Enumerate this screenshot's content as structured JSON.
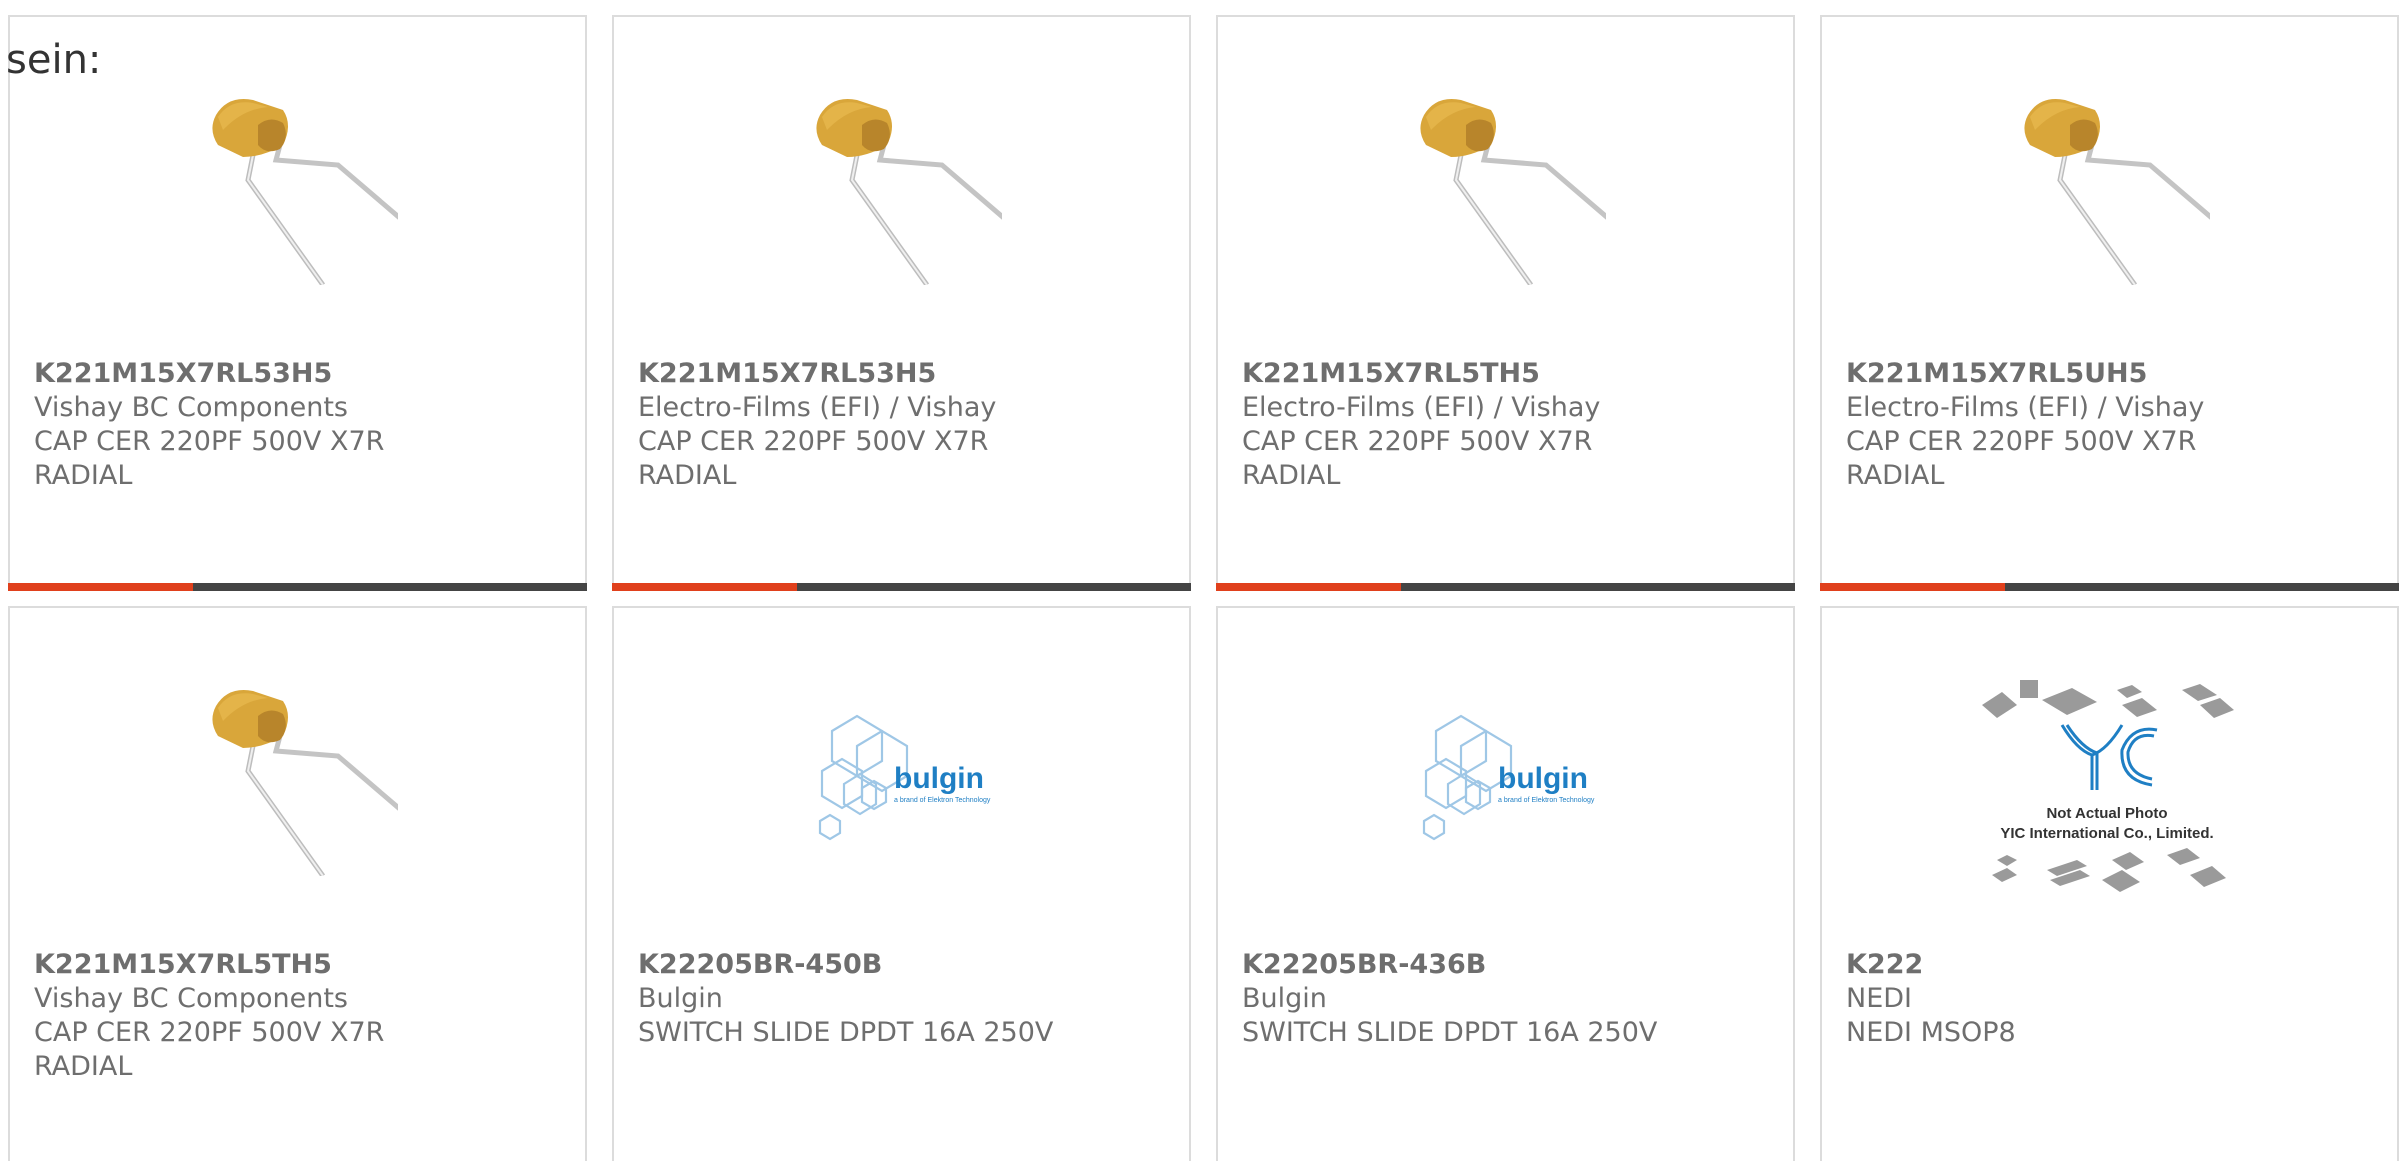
{
  "intro_text": "sein:",
  "colors": {
    "accent": "#e0401c",
    "bar_dark": "#444444",
    "border": "#dcdcdc",
    "text": "#6e6e6e",
    "capacitor_body": "#d9a63a",
    "bulgin_blue": "#1f7fc4"
  },
  "products": [
    {
      "part_number": "K221M15X7RL53H5",
      "manufacturer": "Vishay BC Components",
      "description_line1": "CAP CER 220PF 500V X7R",
      "description_line2": "RADIAL",
      "image": "capacitor-image",
      "bar_visible": true
    },
    {
      "part_number": "K221M15X7RL53H5",
      "manufacturer": "Electro-Films (EFI) / Vishay",
      "description_line1": "CAP CER 220PF 500V X7R",
      "description_line2": "RADIAL",
      "image": "capacitor-image",
      "bar_visible": true
    },
    {
      "part_number": "K221M15X7RL5TH5",
      "manufacturer": "Electro-Films (EFI) / Vishay",
      "description_line1": "CAP CER 220PF 500V X7R",
      "description_line2": "RADIAL",
      "image": "capacitor-image",
      "bar_visible": true
    },
    {
      "part_number": "K221M15X7RL5UH5",
      "manufacturer": "Electro-Films (EFI) / Vishay",
      "description_line1": "CAP CER 220PF 500V X7R",
      "description_line2": "RADIAL",
      "image": "capacitor-image",
      "bar_visible": true
    },
    {
      "part_number": "K221M15X7RL5TH5",
      "manufacturer": "Vishay BC Components",
      "description_line1": "CAP CER 220PF 500V X7R",
      "description_line2": "RADIAL",
      "image": "capacitor-image",
      "bar_visible": false
    },
    {
      "part_number": "K22205BR-450B",
      "manufacturer": "Bulgin",
      "description_line1": "SWITCH SLIDE DPDT 16A 250V",
      "description_line2": "",
      "image": "bulgin-logo",
      "logo_text": "bulgin",
      "logo_subtext": "a brand of Elektron Technology",
      "bar_visible": false
    },
    {
      "part_number": "K22205BR-436B",
      "manufacturer": "Bulgin",
      "description_line1": "SWITCH SLIDE DPDT 16A 250V",
      "description_line2": "",
      "image": "bulgin-logo",
      "logo_text": "bulgin",
      "logo_subtext": "a brand of Elektron Technology",
      "bar_visible": false
    },
    {
      "part_number": "K222",
      "manufacturer": "NEDI",
      "description_line1": "NEDI MSOP8",
      "description_line2": "",
      "image": "yic-placeholder",
      "logo_text": "YIC",
      "placeholder_line1": "Not Actual Photo",
      "placeholder_line2": "YIC International Co., Limited.",
      "bar_visible": false
    }
  ]
}
